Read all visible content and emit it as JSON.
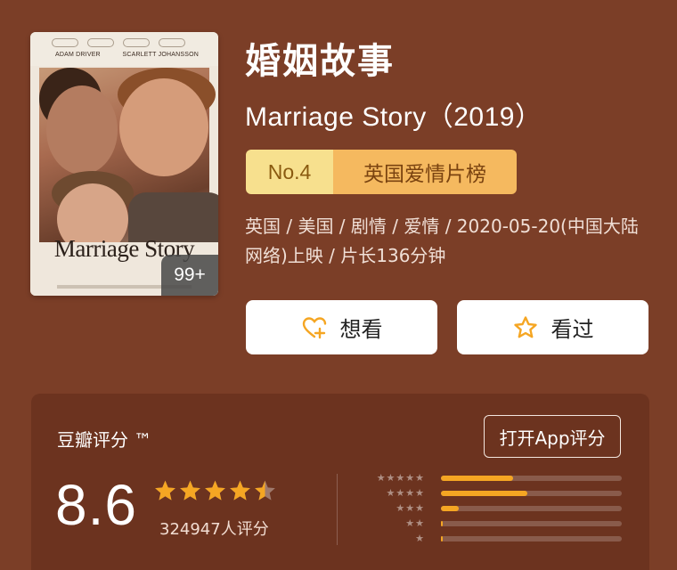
{
  "poster": {
    "actor_left": "ADAM DRIVER",
    "actor_right": "SCARLETT JOHANSSON",
    "title_art": "Marriage Story",
    "badge": "99+"
  },
  "movie": {
    "title_cn": "婚姻故事",
    "title_en": "Marriage Story（2019）",
    "rank_no": "No.4",
    "rank_list": "英国爱情片榜",
    "meta": "英国 / 美国 / 剧情 / 爱情 / 2020-05-20(中国大陆网络)上映 / 片长136分钟"
  },
  "actions": {
    "want_label": "想看",
    "want_icon": "heart-plus-icon",
    "seen_label": "看过",
    "seen_icon": "star-outline-icon"
  },
  "rating": {
    "title": "豆瓣评分 ™",
    "open_app": "打开App评分",
    "score": "8.6",
    "stars_value": 4.5,
    "count": "324947人评分",
    "distribution": [
      {
        "stars": 5,
        "fraction": 0.4
      },
      {
        "stars": 4,
        "fraction": 0.48
      },
      {
        "stars": 3,
        "fraction": 0.1
      },
      {
        "stars": 2,
        "fraction": 0.012
      },
      {
        "stars": 1,
        "fraction": 0.005
      }
    ],
    "colors": {
      "bar": "#f5a623",
      "star": "#f5a623"
    }
  }
}
